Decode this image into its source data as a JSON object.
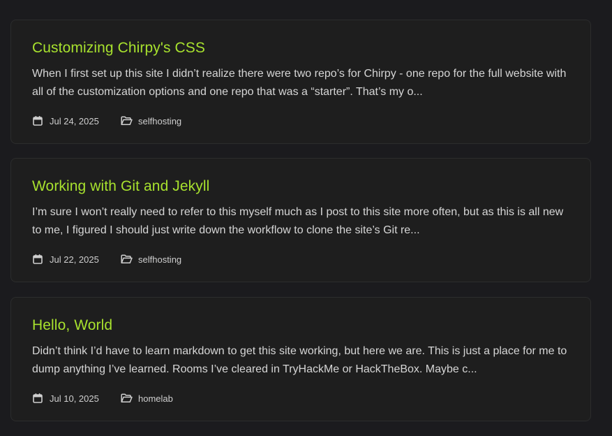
{
  "posts": [
    {
      "title": "Customizing Chirpy's CSS",
      "excerpt": "When I first set up this site I didn’t realize there were two repo’s for Chirpy - one repo for the full website with all of the customization options and one repo that was a “starter”. That’s my o...",
      "date": "Jul 24, 2025",
      "category": "selfhosting"
    },
    {
      "title": "Working with Git and Jekyll",
      "excerpt": "I’m sure I won’t really need to refer to this myself much as I post to this site more often, but as this is all new to me, I figured I should just write down the workflow to clone the site’s Git re...",
      "date": "Jul 22, 2025",
      "category": "selfhosting"
    },
    {
      "title": "Hello, World",
      "excerpt": "Didn’t think I’d have to learn markdown to get this site working, but here we are. This is just a place for me to dump anything I’ve learned. Rooms I’ve cleared in TryHackMe or HackTheBox. Maybe c...",
      "date": "Jul 10, 2025",
      "category": "homelab"
    }
  ],
  "icons": {
    "date": "calendar-icon",
    "category": "folder-open-icon"
  },
  "colors": {
    "background": "#1b1b1e",
    "card": "#1e1e1e",
    "card_border": "#2c2d2d",
    "title": "#a8e22e",
    "text": "#d6d6d6"
  }
}
